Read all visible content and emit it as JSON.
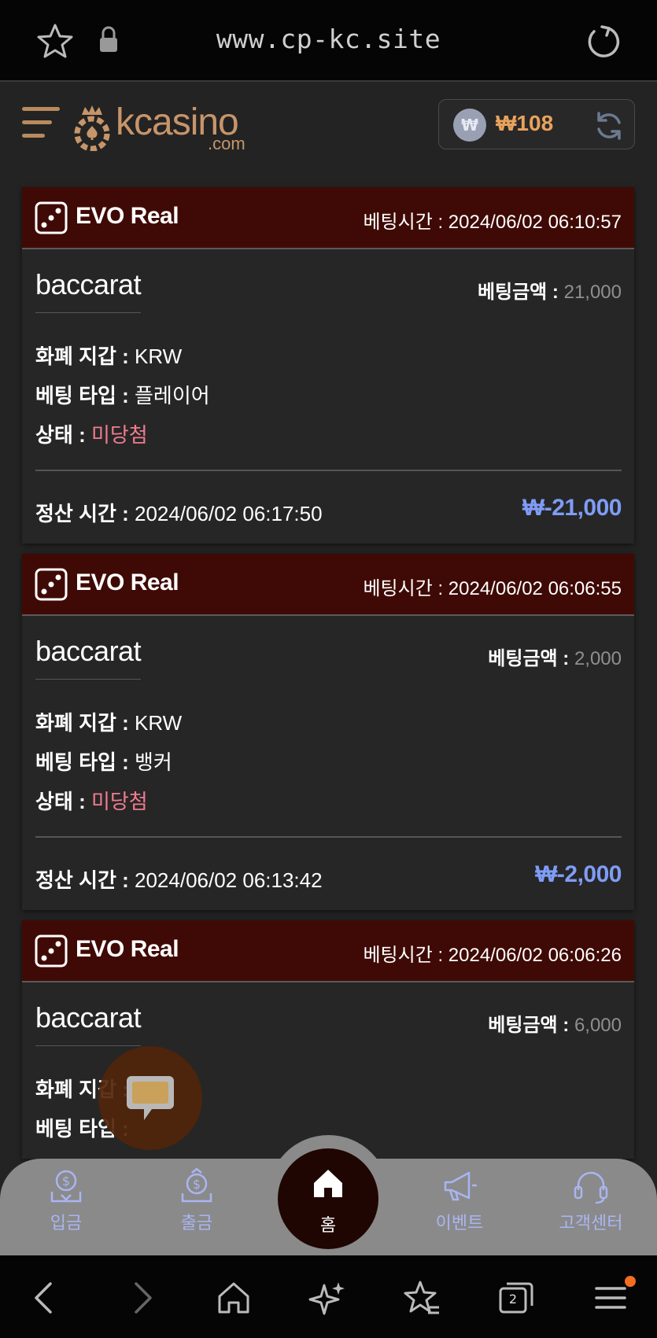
{
  "browser": {
    "url": "www.cp-kc.site",
    "tab_count": "2"
  },
  "header": {
    "logo_text": "kcasino",
    "logo_sub": ".com",
    "coin_symbol": "₩",
    "balance": "₩108"
  },
  "bets": [
    {
      "provider": "EVO Real",
      "bet_time_label": "베팅시간 : ",
      "bet_time": "2024/06/02 06:10:57",
      "game": "baccarat",
      "amount_label": "베팅금액 : ",
      "amount": "21,000",
      "currency_label": "화폐 지갑 : ",
      "currency": "KRW",
      "type_label": "베팅 타입 : ",
      "type": "플레이어",
      "status_label": "상태 : ",
      "status": "미당첨",
      "settle_label": "정산 시간 : ",
      "settle_time": "2024/06/02 06:17:50",
      "profit": "₩-21,000"
    },
    {
      "provider": "EVO Real",
      "bet_time_label": "베팅시간 : ",
      "bet_time": "2024/06/02 06:06:55",
      "game": "baccarat",
      "amount_label": "베팅금액 : ",
      "amount": "2,000",
      "currency_label": "화폐 지갑 : ",
      "currency": "KRW",
      "type_label": "베팅 타입 : ",
      "type": "뱅커",
      "status_label": "상태 : ",
      "status": "미당첨",
      "settle_label": "정산 시간 : ",
      "settle_time": "2024/06/02 06:13:42",
      "profit": "₩-2,000"
    },
    {
      "provider": "EVO Real",
      "bet_time_label": "베팅시간 : ",
      "bet_time": "2024/06/02 06:06:26",
      "game": "baccarat",
      "amount_label": "베팅금액 : ",
      "amount": "6,000",
      "currency_label": "화폐 지갑 : ",
      "type_label": "베팅 타입 : "
    }
  ],
  "nav": {
    "deposit": "입금",
    "withdraw": "출금",
    "home": "홈",
    "event": "이벤트",
    "support": "고객센터"
  },
  "colors": {
    "card_header": "#3f0a05",
    "accent_gold": "#c7956a",
    "profit_blue": "#7f9cf5",
    "status_pink": "#f07c8f",
    "nav_icon": "#aab5f2"
  }
}
